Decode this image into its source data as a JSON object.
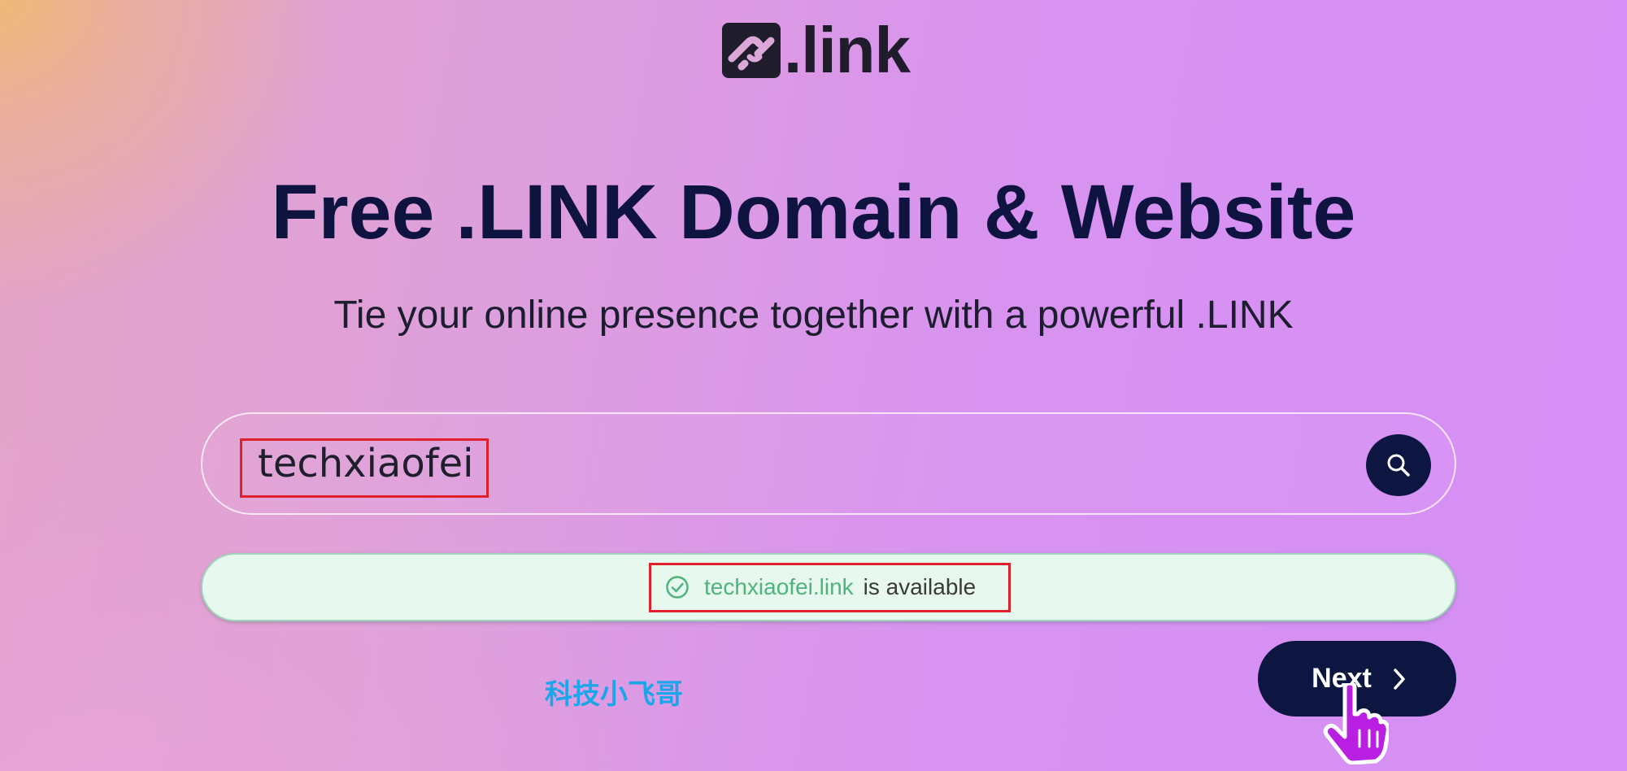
{
  "brand": {
    "logo_text": ".link",
    "logo_icon": "chain-link-icon"
  },
  "hero": {
    "title": "Free .LINK Domain & Website",
    "subtitle": "Tie your online presence together with a powerful .LINK"
  },
  "search": {
    "value": "techxiaofei",
    "button_icon": "search-icon"
  },
  "availability": {
    "icon": "check-circle-icon",
    "domain": "techxiaofei.link",
    "status": "is available"
  },
  "actions": {
    "next_label": "Next",
    "next_icon": "chevron-right-icon"
  },
  "overlay": {
    "watermark": "科技小飞哥",
    "cursor_icon": "hand-pointer-icon"
  },
  "colors": {
    "navy": "#0c1640",
    "heading": "#0e1340",
    "highlight_red": "#e0202a",
    "available_green": "#4fb37d",
    "available_bg": "#e7f8ee",
    "watermark_blue": "#1aa6e8",
    "cursor_purple": "#b81fe0"
  }
}
